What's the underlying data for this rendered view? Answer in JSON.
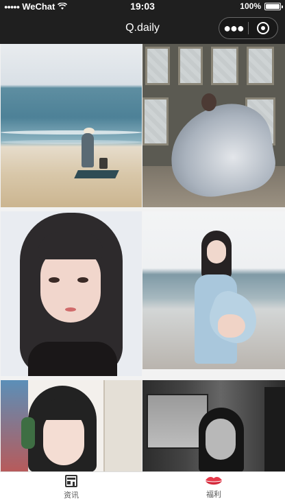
{
  "status_bar": {
    "signal": "●●●●●",
    "carrier": "WeChat",
    "wifi_icon": "wifi-icon",
    "time": "19:03",
    "battery": "100%",
    "battery_level": 1.0
  },
  "nav": {
    "title": "Q.daily",
    "more_icon": "more-dots-icon",
    "close_icon": "close-circle-icon"
  },
  "gallery": {
    "photos": [
      {
        "id": "p1",
        "subject": "beach"
      },
      {
        "id": "p2",
        "subject": "window-room"
      },
      {
        "id": "p3",
        "subject": "portrait"
      },
      {
        "id": "p4",
        "subject": "sea-pose"
      },
      {
        "id": "p5",
        "subject": "headphones"
      },
      {
        "id": "p6",
        "subject": "train"
      }
    ]
  },
  "tab_bar": {
    "tabs": [
      {
        "label": "资讯",
        "icon": "news-icon",
        "active": false
      },
      {
        "label": "福利",
        "icon": "lips-icon",
        "active": true
      }
    ],
    "accent_color": "#e6394a"
  }
}
